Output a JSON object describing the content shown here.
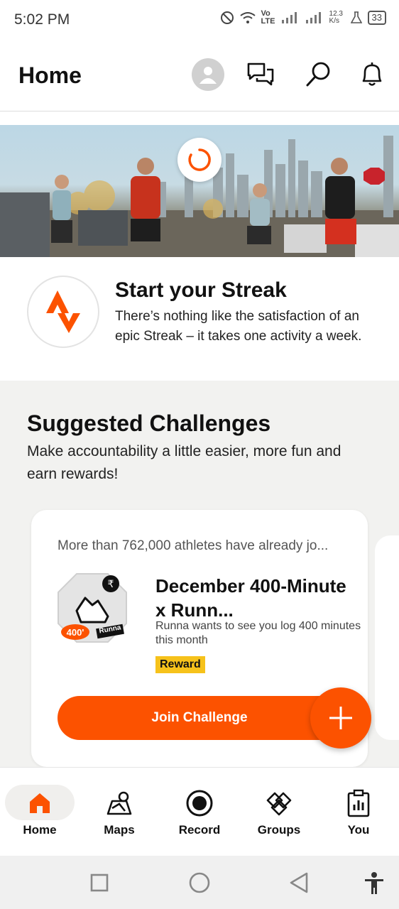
{
  "status_bar": {
    "time": "5:02 PM",
    "network_label": "Vo LTE",
    "speed": "12.3 K/s",
    "battery": "33"
  },
  "header": {
    "title": "Home"
  },
  "streak": {
    "title": "Start your Streak",
    "description": "There’s nothing like the satisfaction of an epic Streak – it takes one activity a week."
  },
  "challenges": {
    "title": "Suggested Challenges",
    "subtitle": "Make accountability a little easier, more fun and earn rewards!",
    "card": {
      "note": "More than 762,000 athletes have already jo...",
      "name": "December 400-Minute x Runn...",
      "description": "Runna wants to see you log 400 minutes this month",
      "badge_number": "400'",
      "badge_brand": "Runna",
      "reward_label": "Reward",
      "join_label": "Join Challenge"
    }
  },
  "bottom_nav": [
    {
      "label": "Home",
      "icon": "home-icon",
      "active": true
    },
    {
      "label": "Maps",
      "icon": "maps-icon",
      "active": false
    },
    {
      "label": "Record",
      "icon": "record-icon",
      "active": false
    },
    {
      "label": "Groups",
      "icon": "groups-icon",
      "active": false
    },
    {
      "label": "You",
      "icon": "you-icon",
      "active": false
    }
  ],
  "colors": {
    "accent": "#fc5200",
    "reward": "#f6c21b"
  }
}
